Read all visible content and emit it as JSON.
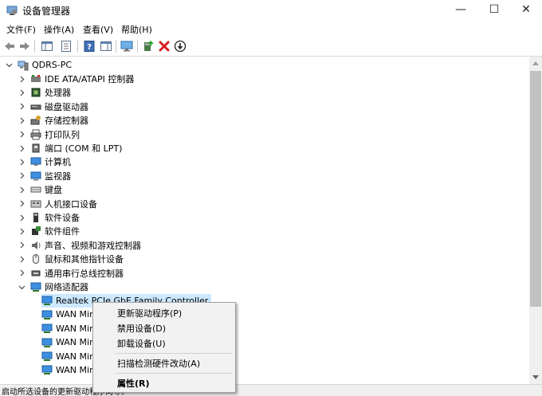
{
  "window": {
    "title": "设备管理器",
    "controls": {
      "minimize": "—",
      "maximize": "☐",
      "close": "✕"
    }
  },
  "menubar": [
    {
      "label": "文件(F)"
    },
    {
      "label": "操作(A)"
    },
    {
      "label": "查看(V)"
    },
    {
      "label": "帮助(H)"
    }
  ],
  "toolbar": [
    "back-icon",
    "forward-icon",
    "show-hide-console-tree-icon",
    "properties-icon",
    "help-icon",
    "show-action-pane-icon",
    "monitor-icon",
    "update-driver-icon",
    "uninstall-icon",
    "disable-icon"
  ],
  "tree": {
    "root": "QDRS-PC",
    "categories": [
      {
        "label": "IDE ATA/ATAPI 控制器",
        "icon": "ide-controller-icon"
      },
      {
        "label": "处理器",
        "icon": "processor-icon"
      },
      {
        "label": "磁盘驱动器",
        "icon": "disk-drive-icon"
      },
      {
        "label": "存储控制器",
        "icon": "storage-controller-icon"
      },
      {
        "label": "打印队列",
        "icon": "printer-icon"
      },
      {
        "label": "端口 (COM 和 LPT)",
        "icon": "port-icon"
      },
      {
        "label": "计算机",
        "icon": "computer-icon"
      },
      {
        "label": "监视器",
        "icon": "monitor-icon"
      },
      {
        "label": "键盘",
        "icon": "keyboard-icon"
      },
      {
        "label": "人机接口设备",
        "icon": "hid-icon"
      },
      {
        "label": "软件设备",
        "icon": "software-device-icon"
      },
      {
        "label": "软件组件",
        "icon": "software-component-icon"
      },
      {
        "label": "声音、视频和游戏控制器",
        "icon": "sound-icon"
      },
      {
        "label": "鼠标和其他指针设备",
        "icon": "mouse-icon"
      },
      {
        "label": "通用串行总线控制器",
        "icon": "usb-icon"
      },
      {
        "label": "网络适配器",
        "icon": "network-adapter-icon"
      }
    ],
    "network_children": [
      {
        "label": "Realtek PCIe GbE Family Controller"
      },
      {
        "label": "WAN Mir"
      },
      {
        "label": "WAN Mir"
      },
      {
        "label": "WAN Mir"
      },
      {
        "label": "WAN Mir"
      },
      {
        "label": "WAN Mir"
      }
    ]
  },
  "context_menu": {
    "items": [
      {
        "label": "更新驱动程序(P)"
      },
      {
        "label": "禁用设备(D)"
      },
      {
        "label": "卸载设备(U)"
      },
      {
        "label": "扫描检测硬件改动(A)"
      },
      {
        "label": "属性(R)"
      }
    ]
  },
  "statusbar": {
    "text": "启动所选设备的更新驱动程序向导。"
  },
  "colors": {
    "selection": "#cce8ff",
    "network_icon": "#1e7fd0",
    "uninstall_red": "#d81e1e"
  }
}
